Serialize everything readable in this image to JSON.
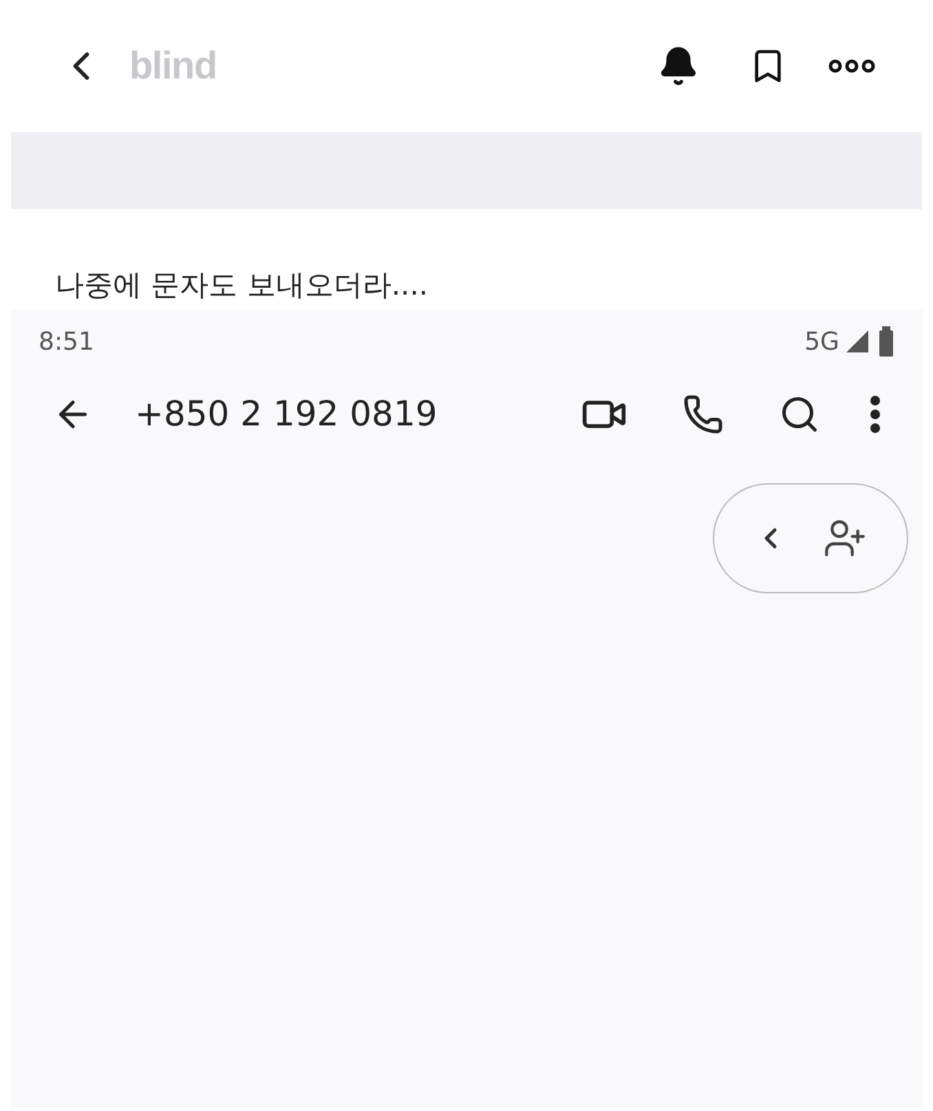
{
  "header": {
    "logo": "blind"
  },
  "post": {
    "text": "나중에 문자도 보내오더라...."
  },
  "screenshot": {
    "status_bar": {
      "time": "8:51",
      "network": "5G"
    },
    "conversation": {
      "title": "+850 2 192 0819"
    }
  }
}
